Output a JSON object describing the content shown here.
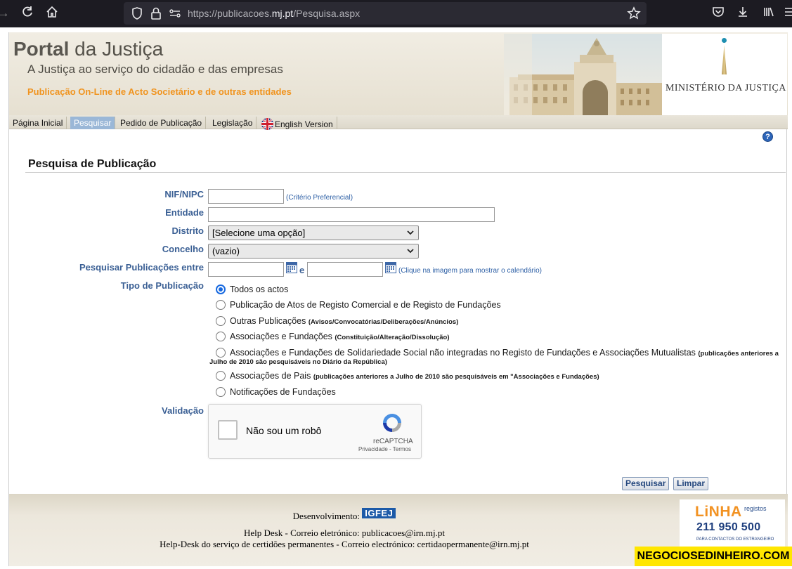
{
  "browser": {
    "url_prefix": "https://publicacoes.",
    "url_domain": "mj.pt",
    "url_path": "/Pesquisa.aspx"
  },
  "header": {
    "title_bold": "Portal",
    "title_rest": " da Justiça",
    "subtitle": "A Justiça ao serviço do cidadão e das empresas",
    "tagline": "Publicação On-Line de Acto Societário e de outras entidades",
    "ministry": "MINISTÉRIO DA JUSTIÇA"
  },
  "nav": {
    "tabs": [
      {
        "label": "Página Inicial"
      },
      {
        "label": "Pesquisar"
      },
      {
        "label": "Pedido de Publicação"
      },
      {
        "label": "Legislação"
      },
      {
        "label": "English Version"
      }
    ],
    "active": "Pesquisar"
  },
  "help_icon": "?",
  "form": {
    "title": "Pesquisa de Publicação",
    "nif_label": "NIF/NIPC",
    "nif_value": "",
    "nif_hint": "(Critério Preferencial)",
    "entidade_label": "Entidade",
    "entidade_value": "",
    "distrito_label": "Distrito",
    "distrito_value": "[Selecione uma opção]",
    "concelho_label": "Concelho",
    "concelho_value": "(vazio)",
    "periodo_label": "Pesquisar Publicações entre",
    "periodo_conn": "e",
    "periodo_hint": "(Clique na imagem para mostrar o calendário)",
    "tipo_label": "Tipo de Publicação",
    "options": [
      {
        "text": "Todos os actos",
        "small": "",
        "selected": true
      },
      {
        "text": "Publicação de Atos de Registo Comercial e de Registo de Fundações",
        "small": "",
        "selected": false
      },
      {
        "text": "Outras Publicações ",
        "small": "(Avisos/Convocatórias/Deliberações/Anúncios)",
        "selected": false
      },
      {
        "text": "Associações e Fundações ",
        "small": "(Constituição/Alteração/Dissolução)",
        "selected": false
      },
      {
        "text": "Associações e Fundações de Solidariedade Social não integradas no Registo de Fundações e Associações Mutualistas ",
        "small": "(publicações anteriores a",
        "selected": false
      },
      {
        "text": "Associações de Pais ",
        "small": "(publicações anteriores a Julho de 2010 são pesquisáveis em \"Associações e Fundações)",
        "selected": false
      },
      {
        "text": "Notificações de Fundações",
        "small": "",
        "selected": false
      }
    ],
    "option5_continuation": "Julho de 2010 são pesquisáveis no Diário da República)",
    "validacao_label": "Validação",
    "captcha_text": "Não sou um robô",
    "captcha_brand": "reCAPTCHA",
    "captcha_links": "Privacidade - Termos",
    "search_button": "Pesquisar",
    "clear_button": "Limpar"
  },
  "footer": {
    "dev_label": "Desenvolvimento:",
    "dev_logo": "IGFEJ",
    "helpdesk": "Help Desk - Correio eletrónico: publicacoes@irn.mj.pt",
    "helpdesk_cert": "Help-Desk do serviço de certidões permanentes - Correio electrónico: certidaopermanente@irn.mj.pt",
    "linha_title": "LiNHA",
    "linha_sub": "registos",
    "linha_phone": "211 950 500",
    "linha_note": "PARA CONTACTOS DO ESTRANGEIRO"
  },
  "watermark": "NEGOCIOSEDINHEIRO.COM",
  "colors": {
    "accent_orange": "#f0941f",
    "label_blue": "#3a5f94",
    "active_tab": "#9ab7d7"
  }
}
